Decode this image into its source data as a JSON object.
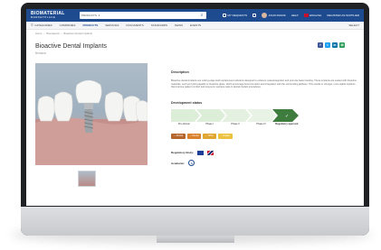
{
  "header": {
    "logo_main": "BIOMATERIAL",
    "logo_sub": "MARKETPLACE",
    "search_category": "PRODUCTS",
    "search_placeholder": "",
    "links": {
      "my_requests": "MY REQUESTS",
      "user": "JOHN FRANK",
      "help": "HELP",
      "language": "ENGLISH",
      "register": "REGISTER AS SUPPLIER"
    }
  },
  "nav": {
    "items": [
      "CATEGORIES",
      "COMPANIES",
      "PRODUCTS",
      "SERVICES",
      "DOCUMENTS",
      "STANDARDS",
      "NEWS",
      "EVENTS"
    ],
    "right": "SELECT"
  },
  "breadcrumb": [
    "Home",
    "Biomaterial",
    "Bioactive Dental Implants"
  ],
  "product": {
    "title": "Bioactive Dental Implants",
    "subtitle": "Bemaca",
    "description_title": "Description",
    "description": "Bioactive dental implants are cutting-edge tooth replacement solutions designed to enhance osseointegration and promote faster healing. These implants are coated with bioactive materials, such as hydroxyapatite or bioactive glass, which encourage bone formation and integration with the surrounding jawbone. This results in stronger, more stable implants that improve patient comfort and long-term success rates in dental implant procedures.",
    "development_title": "Development status",
    "stages": [
      "Pre-clinical",
      "Phase I",
      "Phase II",
      "Phase III",
      "Regulatory approval"
    ],
    "tags": [
      {
        "label": "Clinical",
        "color": "#b6652c"
      },
      {
        "label": "Dental",
        "color": "#d9822b"
      },
      {
        "label": "Ortho",
        "color": "#e0a52e"
      },
      {
        "label": "Implant",
        "color": "#ecc13d"
      }
    ],
    "regulatory_label": "Regulatory Body:",
    "academic_label": "Academic:",
    "academic_icon": "A"
  },
  "share": [
    {
      "name": "facebook",
      "glyph": "f",
      "color": "#3b5998"
    },
    {
      "name": "twitter",
      "glyph": "t",
      "color": "#1da1f2"
    },
    {
      "name": "linkedin",
      "glyph": "in",
      "color": "#0e76a8"
    },
    {
      "name": "email",
      "glyph": "✉",
      "color": "#2e9e58"
    }
  ],
  "colors": {
    "brand": "#1e4b8f",
    "stage_active": "#3f7d3f"
  }
}
